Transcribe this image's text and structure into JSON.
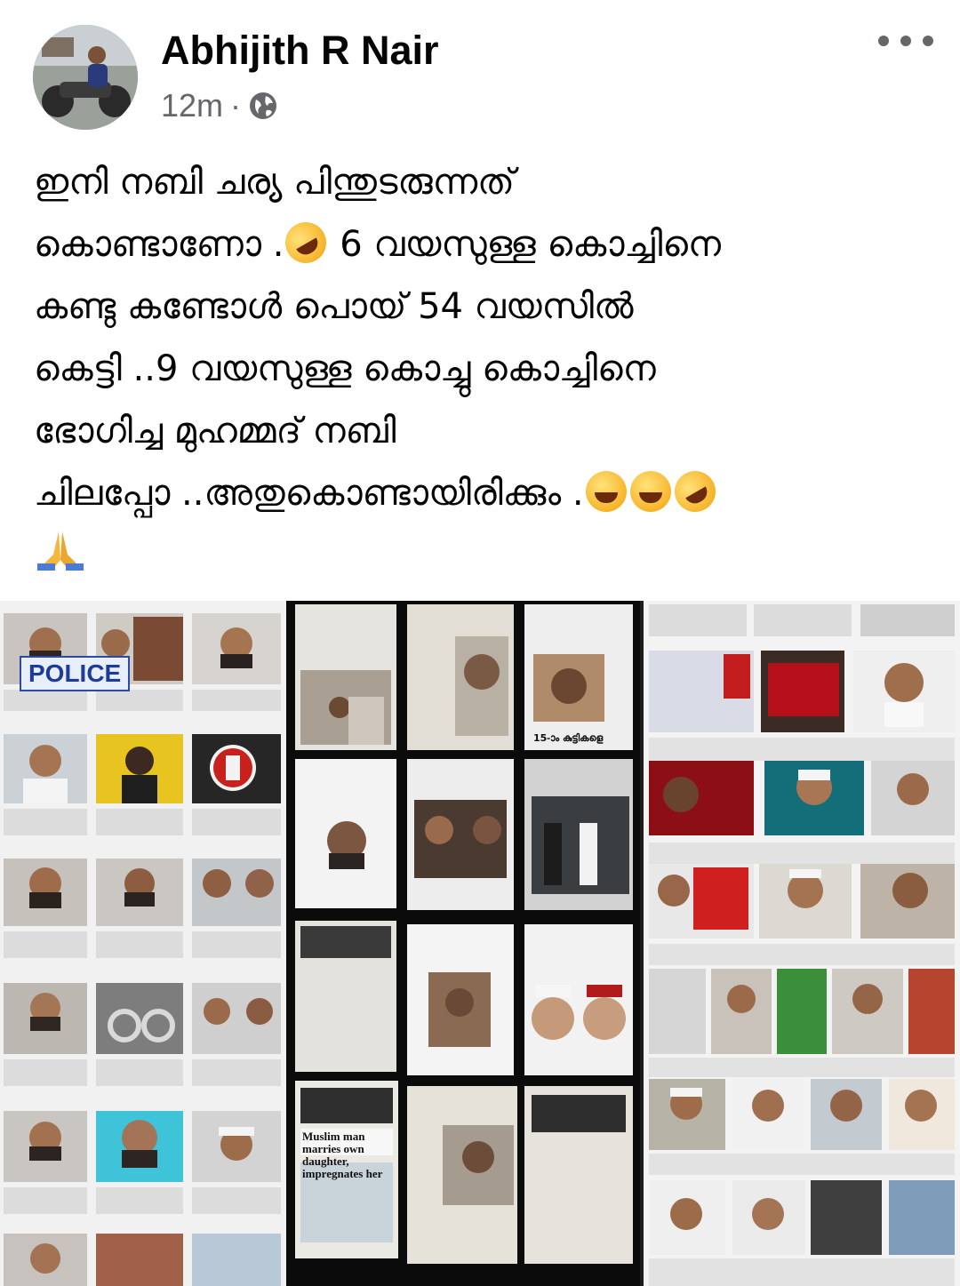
{
  "post": {
    "author": "Abhijith R Nair",
    "time": "12m",
    "separator": "·",
    "privacy_icon": "globe-icon",
    "more_icon": "more-horizontal-icon",
    "text_lines": [
      "ഇനി നബി ചര്യ പിന്തുടരുന്നത്",
      "കൊണ്ടാണോ .",
      " 6 വയസുള്ള കൊച്ചിനെ",
      "കണ്ടു കണ്ടോൾ പൊയ് 54 വയസിൽ",
      "കെട്ടി ..9 വയസുള്ള കൊച്ചു കൊച്ചിനെ",
      "ഭോഗിച്ച മുഹമ്മദ് നബി",
      "ചിലപ്പോ ..അതുകൊണ്ടായിരിക്കും ."
    ],
    "emojis": {
      "line2": "rolling-on-floor-laughing-emoji",
      "line7": [
        "grinning-emoji",
        "laughing-emoji",
        "rolling-on-floor-laughing-emoji"
      ],
      "line8": "folded-hands-emoji"
    }
  },
  "collage": {
    "police_sign": "POLICE",
    "english_headline": "Muslim man marries own daughter, impregnates her",
    "caption": "15-ാം കുട്ടികളെ"
  },
  "colors": {
    "text": "#050505",
    "secondary": "#65676b",
    "background": "#ffffff"
  }
}
